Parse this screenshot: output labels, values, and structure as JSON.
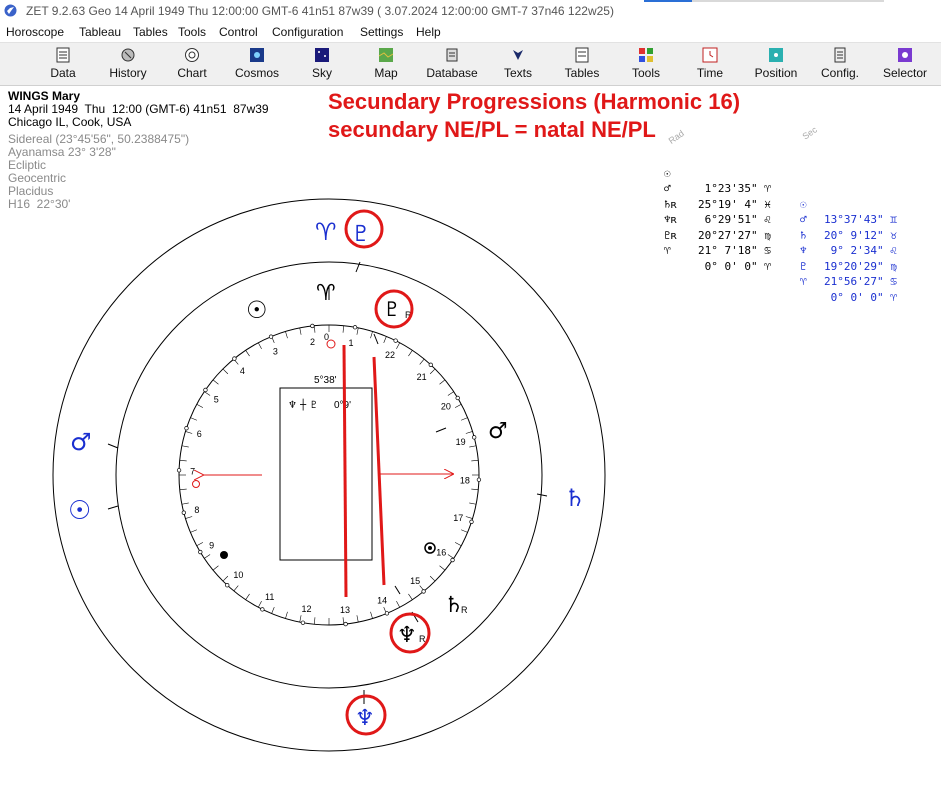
{
  "window": {
    "title": "ZET 9.2.63 Geo   14 April 1949  Thu  12:00:00 GMT-6 41n51  87w39   ( 3.07.2024  12:00:00 GMT-7 37n46 122w25)"
  },
  "menu": [
    "Horoscope",
    "Tableau",
    "Tables",
    "Tools",
    "Control",
    "Configuration",
    "Settings",
    "Help"
  ],
  "toolbar": [
    {
      "label": "Data",
      "icon": "data-icon"
    },
    {
      "label": "History",
      "icon": "history-icon"
    },
    {
      "label": "Chart",
      "icon": "chart-icon"
    },
    {
      "label": "Cosmos",
      "icon": "cosmos-icon"
    },
    {
      "label": "Sky",
      "icon": "sky-icon"
    },
    {
      "label": "Map",
      "icon": "map-icon"
    },
    {
      "label": "Database",
      "icon": "database-icon"
    },
    {
      "label": "Texts",
      "icon": "texts-icon"
    },
    {
      "label": "Tables",
      "icon": "tables-icon"
    },
    {
      "label": "Tools",
      "icon": "tools-icon"
    },
    {
      "label": "Time",
      "icon": "time-icon"
    },
    {
      "label": "Position",
      "icon": "position-icon"
    },
    {
      "label": "Config.",
      "icon": "config-icon"
    },
    {
      "label": "Selector",
      "icon": "selector-icon"
    }
  ],
  "chart_info": {
    "name": "WINGS Mary",
    "date_line": "14 April 1949  Thu  12:00 (GMT-6) 41n51  87w39",
    "place": "Chicago IL, Cook, USA",
    "details": [
      "Sidereal (23°45'56\", 50.2388475\")",
      "Ayanamsa 23° 3'28\"",
      "Ecliptic",
      "Geocentric",
      "Placidus",
      "H16  22°30'"
    ]
  },
  "headline": {
    "line1": "Secundary Progressions (Harmonic 16)",
    "line2": "secundary NE/PL = natal NE/PL"
  },
  "positions": {
    "col_natal_label": "Rad",
    "col_sec_label": "Sec",
    "rows": [
      {
        "g1": "☉",
        "v1": " 1°23'35\" ♈",
        "g2": "☉",
        "v2": "13°37'43\" ♊"
      },
      {
        "g1": "♂",
        "v1": "25°19' 4\" ♓",
        "g2": "♂",
        "v2": "20° 9'12\" ♉"
      },
      {
        "g1": "♄ʀ",
        "v1": " 6°29'51\" ♌",
        "g2": "♄",
        "v2": " 9° 2'34\" ♌"
      },
      {
        "g1": "♆ʀ",
        "v1": "20°27'27\" ♍",
        "g2": "♆",
        "v2": "19°20'29\" ♍"
      },
      {
        "g1": "♇ʀ",
        "v1": "21° 7'18\" ♋",
        "g2": "♇",
        "v2": "21°56'27\" ♋"
      },
      {
        "g1": "♈",
        "v1": " 0° 0' 0\" ♈",
        "g2": "♈",
        "v2": " 0° 0' 0\" ♈"
      }
    ]
  },
  "wheel": {
    "center_box": {
      "angle": "5°38'",
      "formula": "♆ ┼ ♇",
      "value": "0°9'"
    },
    "house_numbers": [
      "1",
      "2",
      "3",
      "4",
      "5",
      "6",
      "7",
      "8",
      "9",
      "10",
      "11",
      "12",
      "13",
      "14",
      "15",
      "16",
      "17",
      "18",
      "19",
      "20",
      "21",
      "22"
    ],
    "zero_mark": "0",
    "natal_glyphs": {
      "sun": "☉",
      "aries": "♈",
      "pluto": "♇",
      "pluto_r": "R",
      "mars": "♂",
      "saturn": "♄",
      "saturn_r": "R",
      "neptune": "♆",
      "neptune_r": "R"
    },
    "sec_glyphs": {
      "aries": "♈",
      "pluto": "♇",
      "mars": "♂",
      "sun": "☉",
      "saturn": "♄",
      "neptune": "♆"
    },
    "colors": {
      "natal": "#000000",
      "secondary": "#1a2fd0",
      "highlight": "#e01818"
    }
  }
}
